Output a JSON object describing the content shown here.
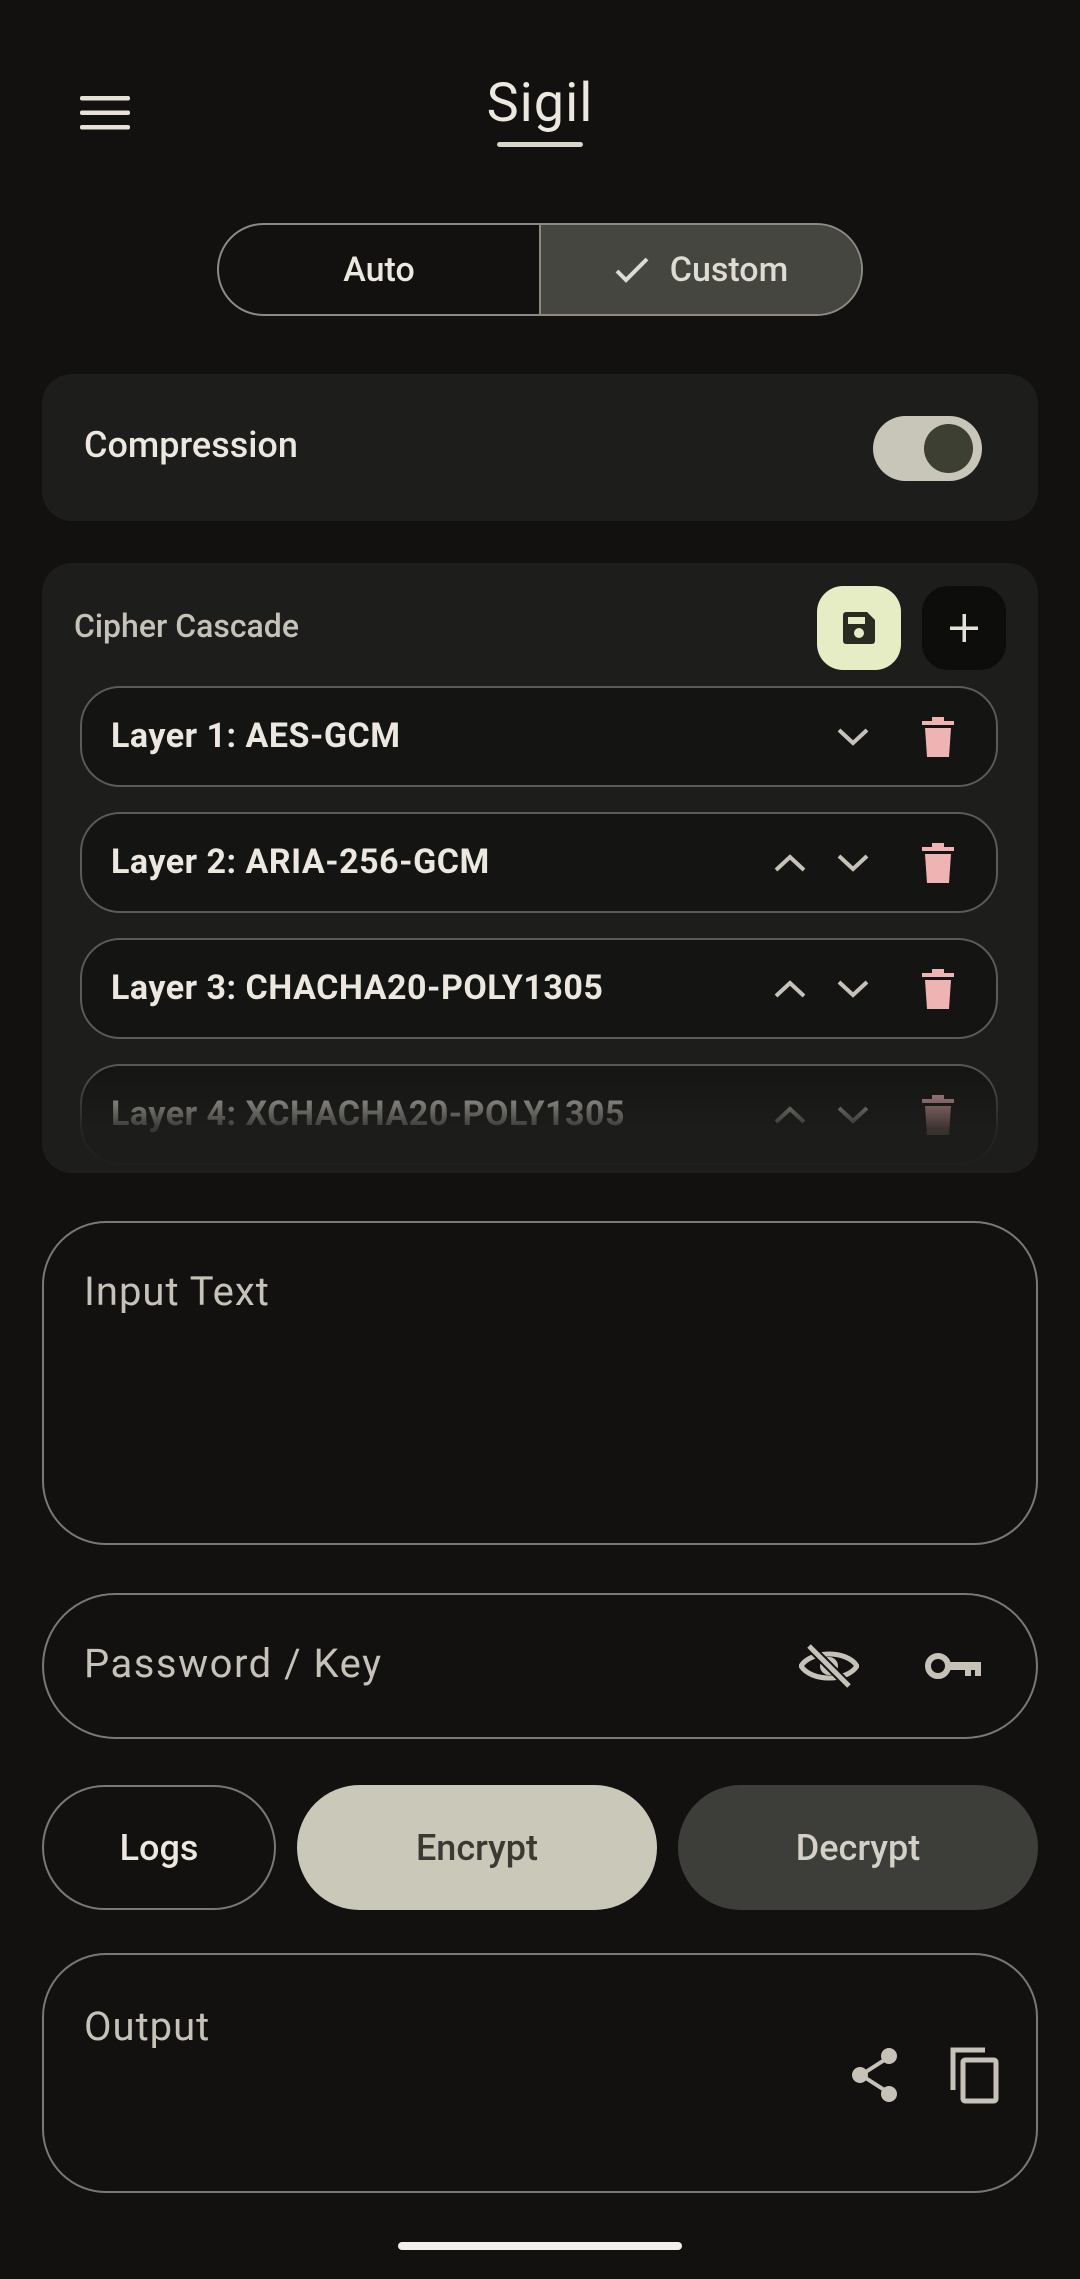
{
  "app": {
    "title": "Sigil"
  },
  "mode": {
    "options": [
      "Auto",
      "Custom"
    ],
    "selected": "Custom"
  },
  "compression": {
    "label": "Compression",
    "enabled": true
  },
  "cascade": {
    "title": "Cipher Cascade",
    "layers": [
      {
        "label": "Layer 1: AES-GCM"
      },
      {
        "label": "Layer 2: ARIA-256-GCM"
      },
      {
        "label": "Layer 3: CHACHA20-POLY1305"
      },
      {
        "label": "Layer 4: XCHACHA20-POLY1305"
      }
    ]
  },
  "input": {
    "placeholder": "Input Text"
  },
  "password": {
    "placeholder": "Password / Key"
  },
  "actions": {
    "logs": "Logs",
    "encrypt": "Encrypt",
    "decrypt": "Decrypt"
  },
  "output": {
    "label": "Output"
  },
  "icons": {
    "menu": "menu-icon",
    "check": "check-icon",
    "save": "save-icon",
    "add": "plus-icon",
    "up": "chevron-up-icon",
    "down": "chevron-down-icon",
    "delete": "trash-icon",
    "visibility": "eye-off-icon",
    "key": "key-icon",
    "share": "share-icon",
    "copy": "copy-icon"
  },
  "colors": {
    "background": "#121110",
    "card": "#1d1d1b",
    "primary": "#cac8b9",
    "save_accent": "#e6ecc4",
    "delete_accent": "#f0b3b3",
    "secondary_button": "#3d3d39"
  }
}
